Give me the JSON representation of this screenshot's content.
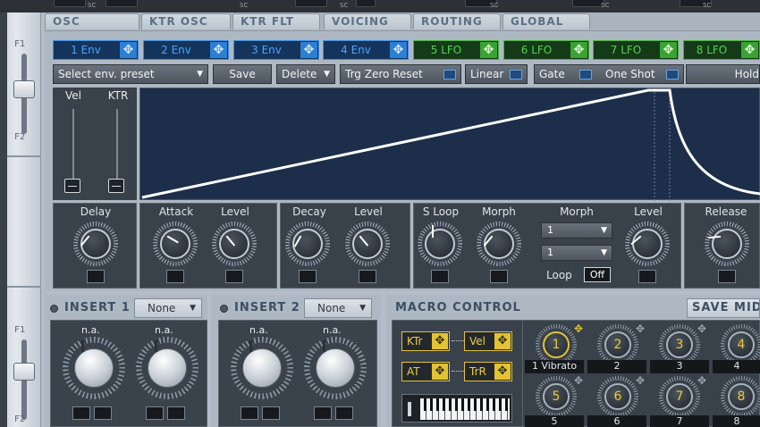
{
  "top_strip": {
    "sc_label": "SC"
  },
  "left_rail": {
    "fader_top_label": "F1",
    "fader_bottom_label": "F2"
  },
  "tabs": [
    "OSC",
    "KTR OSC",
    "KTR FLT",
    "VOICING",
    "ROUTING",
    "GLOBAL"
  ],
  "env_tabs": [
    {
      "label": "1 Env",
      "type": "env"
    },
    {
      "label": "2 Env",
      "type": "env"
    },
    {
      "label": "3 Env",
      "type": "env"
    },
    {
      "label": "4 Env",
      "type": "env"
    },
    {
      "label": "5 LFO",
      "type": "lfo"
    },
    {
      "label": "6 LFO",
      "type": "lfo"
    },
    {
      "label": "7 LFO",
      "type": "lfo"
    },
    {
      "label": "8 LFO",
      "type": "lfo"
    }
  ],
  "toolbar": {
    "preset_select": "Select env. preset",
    "save_label": "Save",
    "delete_label": "Delete",
    "trg_zero_reset_label": "Trg Zero Reset",
    "linear_label": "Linear",
    "gate_label": "Gate",
    "one_shot_label": "One Shot",
    "hold_label": "Hold"
  },
  "side_sliders": {
    "vel_label": "Vel",
    "ktr_label": "KTR"
  },
  "knob_sections": {
    "delay": "Delay",
    "attack": "Attack",
    "attack_level": "Level",
    "decay": "Decay",
    "decay_level": "Level",
    "sloop": "S Loop",
    "morph": "Morph",
    "morph_label": "Morph",
    "morph_value_1": "1",
    "morph_value_2": "1",
    "loop_label": "Loop",
    "loop_value": "Off",
    "level": "Level",
    "release": "Release"
  },
  "inserts": [
    {
      "title": "INSERT 1",
      "mode": "None",
      "knob_labels": [
        "n.a.",
        "n.a."
      ],
      "sc_label": "SC"
    },
    {
      "title": "INSERT 2",
      "mode": "None",
      "knob_labels": [
        "n.a.",
        "n.a."
      ],
      "sc_label": "SC"
    }
  ],
  "macro": {
    "title": "MACRO CONTROL",
    "save_label": "SAVE MID",
    "sources": [
      "KTr",
      "Vel",
      "AT",
      "TrR"
    ],
    "knobs_row1": [
      {
        "num": "1",
        "name": "1 Vibrato"
      },
      {
        "num": "2",
        "name": "2"
      },
      {
        "num": "3",
        "name": "3"
      },
      {
        "num": "4",
        "name": "4"
      }
    ],
    "knobs_row2": [
      {
        "num": "5",
        "name": "5"
      },
      {
        "num": "6",
        "name": "6"
      },
      {
        "num": "7",
        "name": "7"
      },
      {
        "num": "8",
        "name": "8"
      }
    ]
  },
  "colors": {
    "env_accent": "#3f8de0",
    "lfo_accent": "#4ab23d",
    "macro_accent": "#e3c234",
    "graph_bg": "#1c2e49"
  },
  "icons": {
    "move": "move-arrows-icon",
    "dropdown": "chevron-down-icon",
    "power": "power-led-icon"
  }
}
